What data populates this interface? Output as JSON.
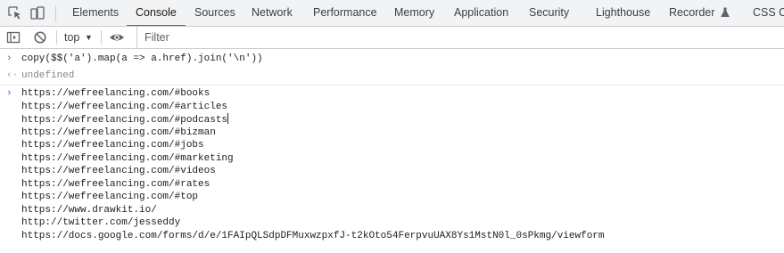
{
  "tabs": [
    {
      "label": "Elements",
      "active": false
    },
    {
      "label": "Console",
      "active": true
    },
    {
      "label": "Sources",
      "active": false
    },
    {
      "label": "Network",
      "active": false
    },
    {
      "label": "Performance",
      "active": false
    },
    {
      "label": "Memory",
      "active": false
    },
    {
      "label": "Application",
      "active": false
    },
    {
      "label": "Security",
      "active": false
    },
    {
      "label": "Lighthouse",
      "active": false
    },
    {
      "label": "Recorder",
      "active": false
    },
    {
      "label": "CSS Ov",
      "active": false
    }
  ],
  "toolbar": {
    "context": "top",
    "filter_placeholder": "Filter"
  },
  "console": {
    "command": "copy($$('a').map(a => a.href).join('\\n'))",
    "result": "undefined",
    "output_lines": [
      "https://wefreelancing.com/#books",
      "https://wefreelancing.com/#articles",
      "https://wefreelancing.com/#podcasts",
      "https://wefreelancing.com/#bizman",
      "https://wefreelancing.com/#jobs",
      "https://wefreelancing.com/#marketing",
      "https://wefreelancing.com/#videos",
      "https://wefreelancing.com/#rates",
      "https://wefreelancing.com/#top",
      "https://www.drawkit.io/",
      "http://twitter.com/jesseddy",
      "https://docs.google.com/forms/d/e/1FAIpQLSdpDFMuxwzpxfJ-t2kOto54FerpvuUAX8Ys1MstN0l_0sPkmg/viewform"
    ]
  },
  "colors": {
    "accent": "#1a73e8",
    "toolbar_bg": "#f1f3f4",
    "border": "#cbcdd1",
    "prompt": "#1a73e8",
    "muted": "#80868b"
  },
  "icons": {
    "inspect": "inspect-element-icon",
    "device": "device-toolbar-icon",
    "sidebar": "show-sidebar-icon",
    "clear": "clear-console-icon",
    "eye": "live-expression-icon",
    "recorder": "flask-icon"
  }
}
